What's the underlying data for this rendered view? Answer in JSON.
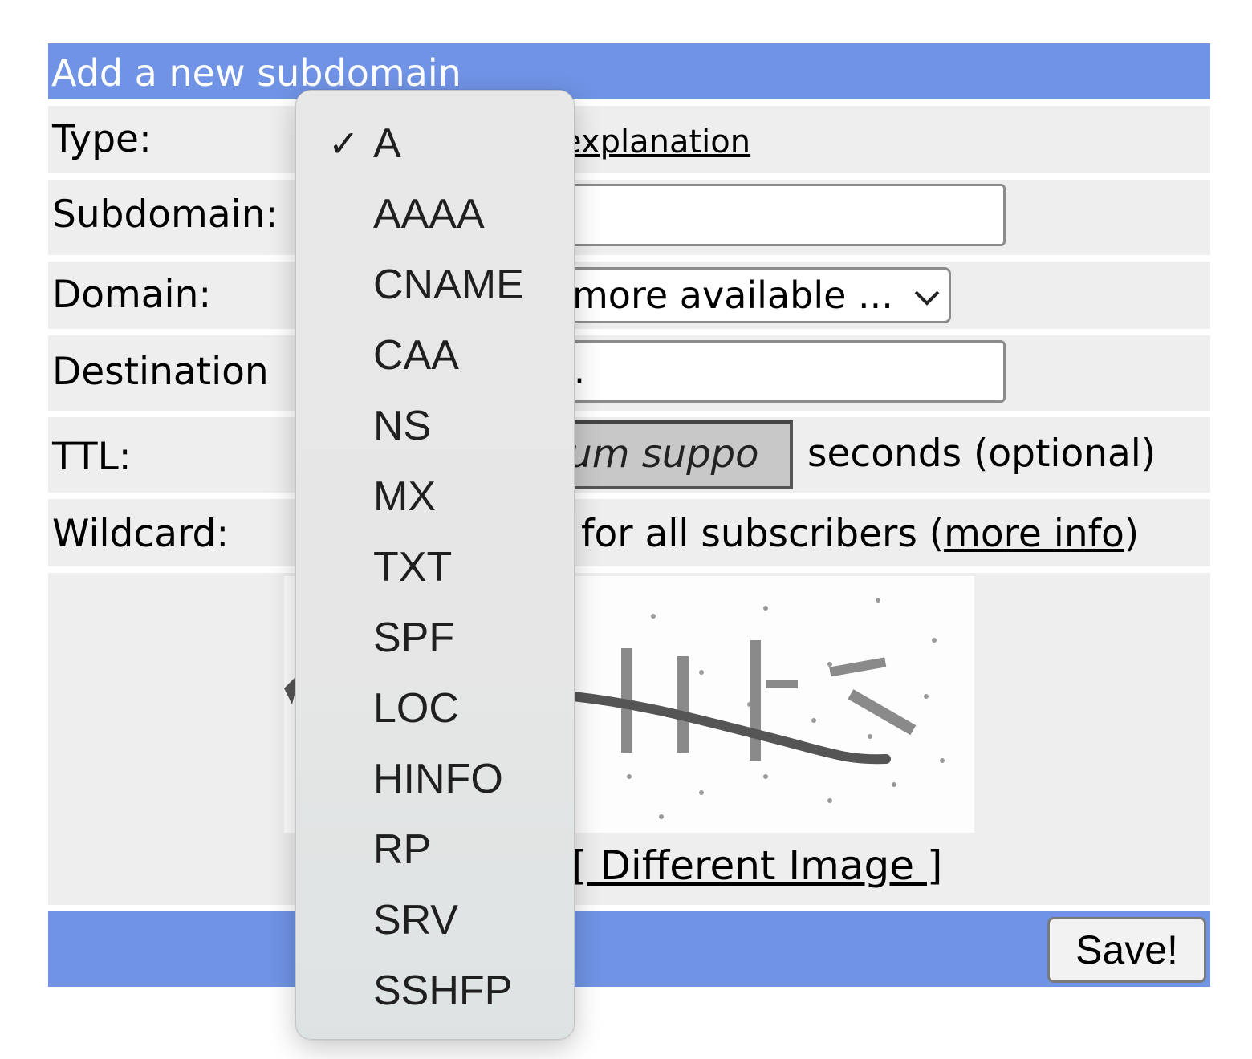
{
  "form": {
    "title": "Add a new subdomain",
    "rows": {
      "type": {
        "label": "Type:",
        "link_text": "explanation"
      },
      "subdomain": {
        "label": "Subdomain:",
        "value": ""
      },
      "domain": {
        "label": "Domain:",
        "selected_text": "more available ..."
      },
      "destination": {
        "label": "Destination",
        "value": "."
      },
      "ttl": {
        "label": "TTL:",
        "value": "ium suppo",
        "suffix": "seconds (optional)"
      },
      "wildcard": {
        "label": "Wildcard:",
        "text": "for all subscribers (",
        "link_text": "more info",
        "text_end": ")"
      }
    },
    "captcha": {
      "different_image_link": "[ Different Image ]"
    },
    "save_label": "Save!"
  },
  "type_dropdown": {
    "selected": "A",
    "check_mark": "✓",
    "options": [
      "A",
      "AAAA",
      "CNAME",
      "CAA",
      "NS",
      "MX",
      "TXT",
      "SPF",
      "LOC",
      "HINFO",
      "RP",
      "SRV",
      "SSHFP"
    ]
  },
  "colors": {
    "header_bg": "#7093e5",
    "row_bg": "#eeeeee",
    "dropdown_bg": "#e8e8e8"
  },
  "icons": {
    "domain_select": "chevron-down-icon",
    "selected_option": "checkmark-icon"
  }
}
